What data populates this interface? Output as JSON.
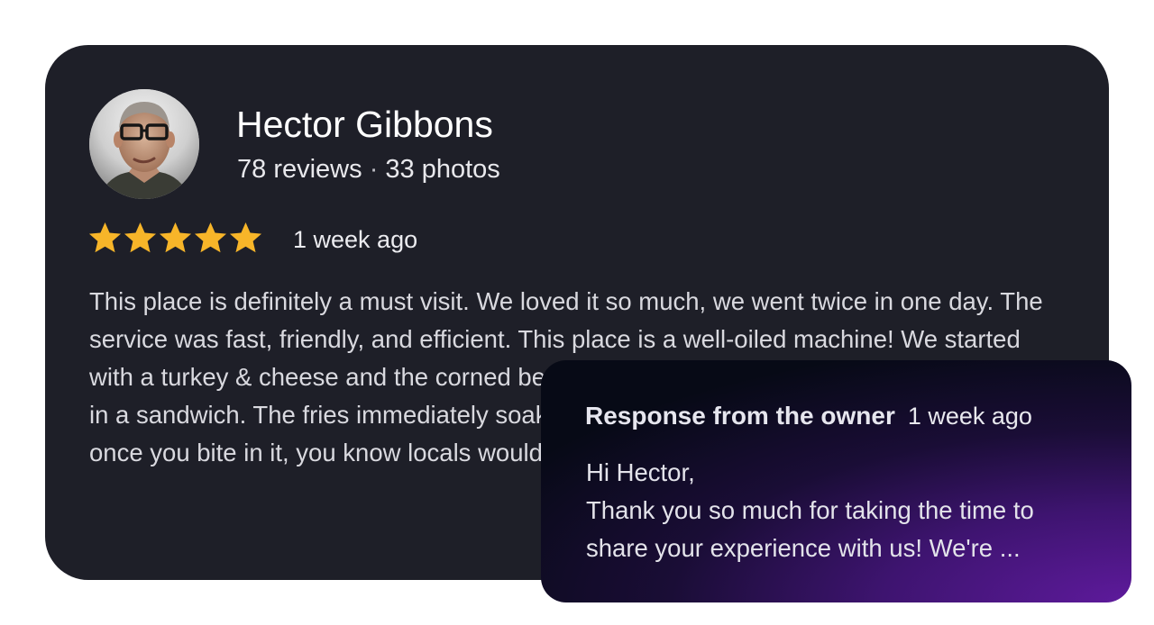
{
  "review": {
    "reviewer_name": "Hector Gibbons",
    "reviews_count": "78 reviews",
    "meta_separator": "·",
    "photos_count": "33 photos",
    "rating": 5,
    "rating_max": 5,
    "time_ago": "1 week ago",
    "text": "This place is definitely a must visit. We loved it so much, we went twice in one day. The service was fast, friendly, and efficient. This place is a well-oiled machine! We started with a turkey & cheese and the corned beef \"as is.\" They go through fries and put them in a sandwich. The fries immediately soaked and you could taste on the sandwich. So once you bite in it, you know locals would scoff at this technique."
  },
  "response": {
    "title": "Response from the owner",
    "time_ago": "1 week ago",
    "greeting": "Hi Hector,",
    "line1": "Thank you so much for taking the time to",
    "line2": "share your experience with us! We're ..."
  },
  "colors": {
    "card_background": "#1e1f28",
    "star": "#f7b529",
    "response_gradient_start": "#070a16",
    "response_gradient_end": "#5e1a9c"
  },
  "icons": {
    "star": "star-icon",
    "avatar": "avatar"
  }
}
